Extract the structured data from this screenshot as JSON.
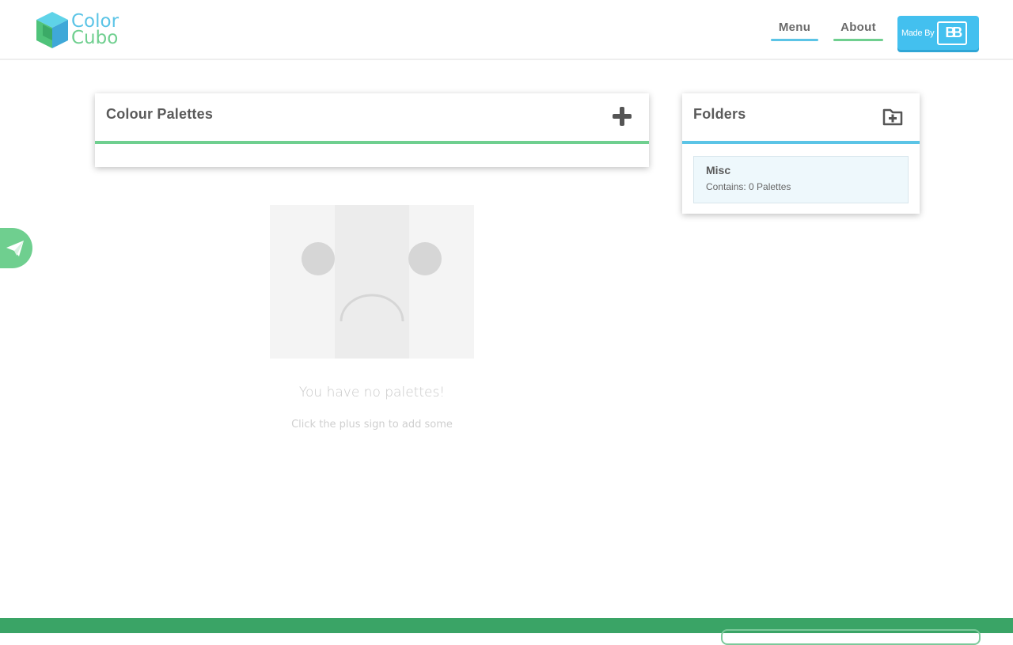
{
  "header": {
    "logo_line1": "Color",
    "logo_line2": "Cubo",
    "nav_menu": "Menu",
    "nav_about": "About",
    "madeby_label": "Made By",
    "madeby_logo": "BB"
  },
  "palettes": {
    "title": "Colour Palettes",
    "add_icon": "plus-icon"
  },
  "folders": {
    "title": "Folders",
    "add_icon": "folder-plus-icon",
    "items": [
      {
        "name": "Misc",
        "count_text": "Contains: 0 Palettes"
      }
    ]
  },
  "empty_state": {
    "title": "You have no palettes!",
    "subtitle": "Click the plus sign to add some"
  },
  "share": {
    "icon": "paper-plane-icon"
  },
  "colors": {
    "blue": "#5bc4e6",
    "green": "#6fcf8f",
    "footer_green": "#3aa466",
    "madeby_blue": "#43c0ef"
  }
}
